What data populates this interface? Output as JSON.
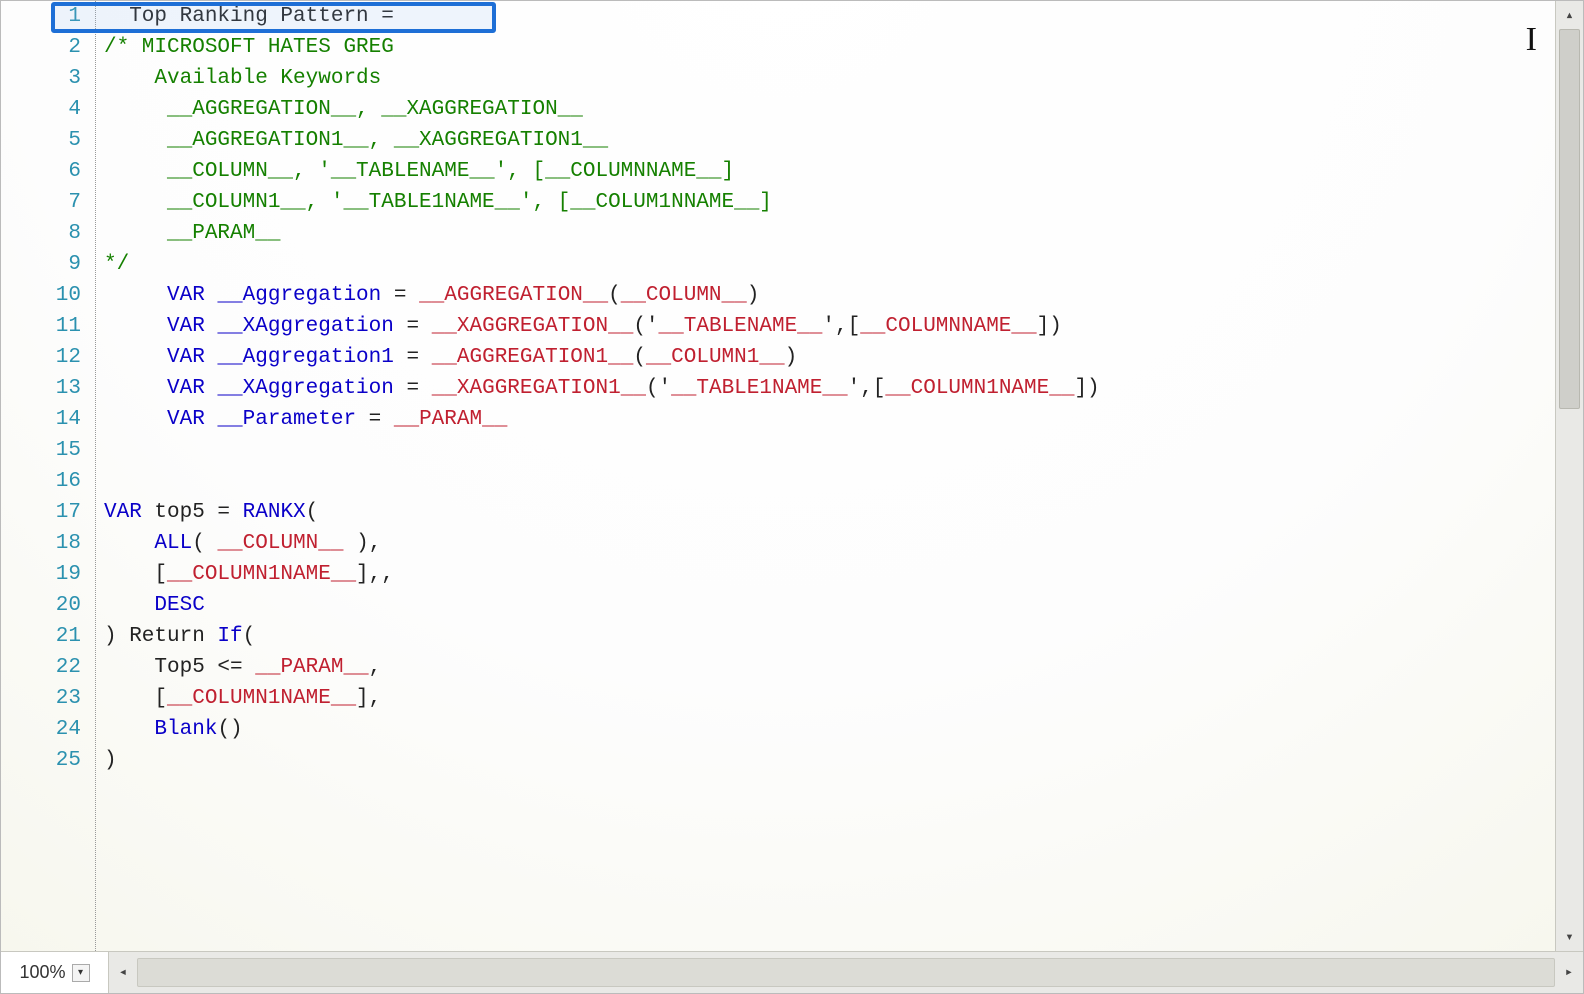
{
  "zoom": {
    "level": "100%"
  },
  "line_count": 25,
  "code_lines": [
    {
      "n": 1,
      "tokens": [
        {
          "c": "default",
          "t": "  Top Ranking Pattern ="
        }
      ]
    },
    {
      "n": 2,
      "tokens": [
        {
          "c": "comment",
          "t": "/* MICROSOFT HATES GREG"
        }
      ]
    },
    {
      "n": 3,
      "tokens": [
        {
          "c": "comment",
          "t": "    Available Keywords"
        }
      ]
    },
    {
      "n": 4,
      "tokens": [
        {
          "c": "comment",
          "t": "     __AGGREGATION__, __XAGGREGATION__"
        }
      ]
    },
    {
      "n": 5,
      "tokens": [
        {
          "c": "comment",
          "t": "     __AGGREGATION1__, __XAGGREGATION1__"
        }
      ]
    },
    {
      "n": 6,
      "tokens": [
        {
          "c": "comment",
          "t": "     __COLUMN__, '__TABLENAME__', [__COLUMNNAME__]"
        }
      ]
    },
    {
      "n": 7,
      "tokens": [
        {
          "c": "comment",
          "t": "     __COLUMN1__, '__TABLE1NAME__', [__COLUM1NNAME__]"
        }
      ]
    },
    {
      "n": 8,
      "tokens": [
        {
          "c": "comment",
          "t": "     __PARAM__"
        }
      ]
    },
    {
      "n": 9,
      "tokens": [
        {
          "c": "comment",
          "t": "*/"
        }
      ]
    },
    {
      "n": 10,
      "tokens": [
        {
          "c": "default",
          "t": "     "
        },
        {
          "c": "kw",
          "t": "VAR"
        },
        {
          "c": "default",
          "t": " "
        },
        {
          "c": "paramblue",
          "t": "__Aggregation"
        },
        {
          "c": "default",
          "t": " = "
        },
        {
          "c": "param",
          "t": "__AGGREGATION__"
        },
        {
          "c": "default",
          "t": "("
        },
        {
          "c": "param",
          "t": "__COLUMN__"
        },
        {
          "c": "default",
          "t": ")"
        }
      ]
    },
    {
      "n": 11,
      "tokens": [
        {
          "c": "default",
          "t": "     "
        },
        {
          "c": "kw",
          "t": "VAR"
        },
        {
          "c": "default",
          "t": " "
        },
        {
          "c": "paramblue",
          "t": "__XAggregation"
        },
        {
          "c": "default",
          "t": " = "
        },
        {
          "c": "param",
          "t": "__XAGGREGATION__"
        },
        {
          "c": "default",
          "t": "('"
        },
        {
          "c": "param",
          "t": "__TABLENAME__"
        },
        {
          "c": "default",
          "t": "',["
        },
        {
          "c": "param",
          "t": "__COLUMNNAME__"
        },
        {
          "c": "default",
          "t": "])"
        }
      ]
    },
    {
      "n": 12,
      "tokens": [
        {
          "c": "default",
          "t": "     "
        },
        {
          "c": "kw",
          "t": "VAR"
        },
        {
          "c": "default",
          "t": " "
        },
        {
          "c": "paramblue",
          "t": "__Aggregation1"
        },
        {
          "c": "default",
          "t": " = "
        },
        {
          "c": "param",
          "t": "__AGGREGATION1__"
        },
        {
          "c": "default",
          "t": "("
        },
        {
          "c": "param",
          "t": "__COLUMN1__"
        },
        {
          "c": "default",
          "t": ")"
        }
      ]
    },
    {
      "n": 13,
      "tokens": [
        {
          "c": "default",
          "t": "     "
        },
        {
          "c": "kw",
          "t": "VAR"
        },
        {
          "c": "default",
          "t": " "
        },
        {
          "c": "paramblue",
          "t": "__XAggregation"
        },
        {
          "c": "default",
          "t": " = "
        },
        {
          "c": "param",
          "t": "__XAGGREGATION1__"
        },
        {
          "c": "default",
          "t": "('"
        },
        {
          "c": "param",
          "t": "__TABLE1NAME__"
        },
        {
          "c": "default",
          "t": "',["
        },
        {
          "c": "param",
          "t": "__COLUMN1NAME__"
        },
        {
          "c": "default",
          "t": "])"
        }
      ]
    },
    {
      "n": 14,
      "tokens": [
        {
          "c": "default",
          "t": "     "
        },
        {
          "c": "kw",
          "t": "VAR"
        },
        {
          "c": "default",
          "t": " "
        },
        {
          "c": "paramblue",
          "t": "__Parameter"
        },
        {
          "c": "default",
          "t": " = "
        },
        {
          "c": "param",
          "t": "__PARAM__"
        }
      ]
    },
    {
      "n": 15,
      "tokens": [
        {
          "c": "default",
          "t": ""
        }
      ]
    },
    {
      "n": 16,
      "tokens": [
        {
          "c": "default",
          "t": ""
        }
      ]
    },
    {
      "n": 17,
      "tokens": [
        {
          "c": "kw",
          "t": "VAR"
        },
        {
          "c": "default",
          "t": " top5 = "
        },
        {
          "c": "func",
          "t": "RANKX"
        },
        {
          "c": "default",
          "t": "("
        }
      ]
    },
    {
      "n": 18,
      "tokens": [
        {
          "c": "default",
          "t": "    "
        },
        {
          "c": "func",
          "t": "ALL"
        },
        {
          "c": "default",
          "t": "( "
        },
        {
          "c": "param",
          "t": "__COLUMN__"
        },
        {
          "c": "default",
          "t": " ),"
        }
      ]
    },
    {
      "n": 19,
      "tokens": [
        {
          "c": "default",
          "t": "    ["
        },
        {
          "c": "param",
          "t": "__COLUMN1NAME__"
        },
        {
          "c": "default",
          "t": "],,"
        }
      ]
    },
    {
      "n": 20,
      "tokens": [
        {
          "c": "default",
          "t": "    "
        },
        {
          "c": "func",
          "t": "DESC"
        }
      ]
    },
    {
      "n": 21,
      "tokens": [
        {
          "c": "default",
          "t": ") Return "
        },
        {
          "c": "func",
          "t": "If"
        },
        {
          "c": "default",
          "t": "("
        }
      ]
    },
    {
      "n": 22,
      "tokens": [
        {
          "c": "default",
          "t": "    Top5 <= "
        },
        {
          "c": "param",
          "t": "__PARAM__"
        },
        {
          "c": "default",
          "t": ","
        }
      ]
    },
    {
      "n": 23,
      "tokens": [
        {
          "c": "default",
          "t": "    ["
        },
        {
          "c": "param",
          "t": "__COLUMN1NAME__"
        },
        {
          "c": "default",
          "t": "],"
        }
      ]
    },
    {
      "n": 24,
      "tokens": [
        {
          "c": "default",
          "t": "    "
        },
        {
          "c": "func",
          "t": "Blank"
        },
        {
          "c": "default",
          "t": "()"
        }
      ]
    },
    {
      "n": 25,
      "tokens": [
        {
          "c": "default",
          "t": ")"
        }
      ]
    }
  ]
}
